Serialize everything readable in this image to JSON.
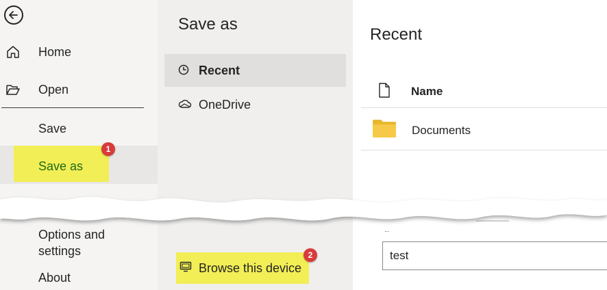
{
  "nav": {
    "items": [
      {
        "label": "Home"
      },
      {
        "label": "Open"
      },
      {
        "label": "Save"
      },
      {
        "label": "Save as"
      },
      {
        "label": "Options and settings"
      },
      {
        "label": "About"
      }
    ],
    "options_line1": "Options and",
    "options_line2": "settings",
    "save_as_badge": "1"
  },
  "save_as_panel": {
    "title": "Save as",
    "locations": [
      {
        "label": "Recent",
        "icon": "clock-icon",
        "selected": true
      },
      {
        "label": "OneDrive",
        "icon": "cloud-icon",
        "selected": false
      }
    ],
    "browse": {
      "label": "Browse this device",
      "badge": "2"
    }
  },
  "main": {
    "title": "Recent",
    "column_header": "Name",
    "rows": [
      {
        "name": "Documents",
        "icon": "folder-icon"
      }
    ],
    "filename_value": "test"
  },
  "colors": {
    "highlight": "#f2ee55",
    "badge": "#d93a3a",
    "selected_label": "#1e6b1a",
    "folder": "#f7c948"
  }
}
